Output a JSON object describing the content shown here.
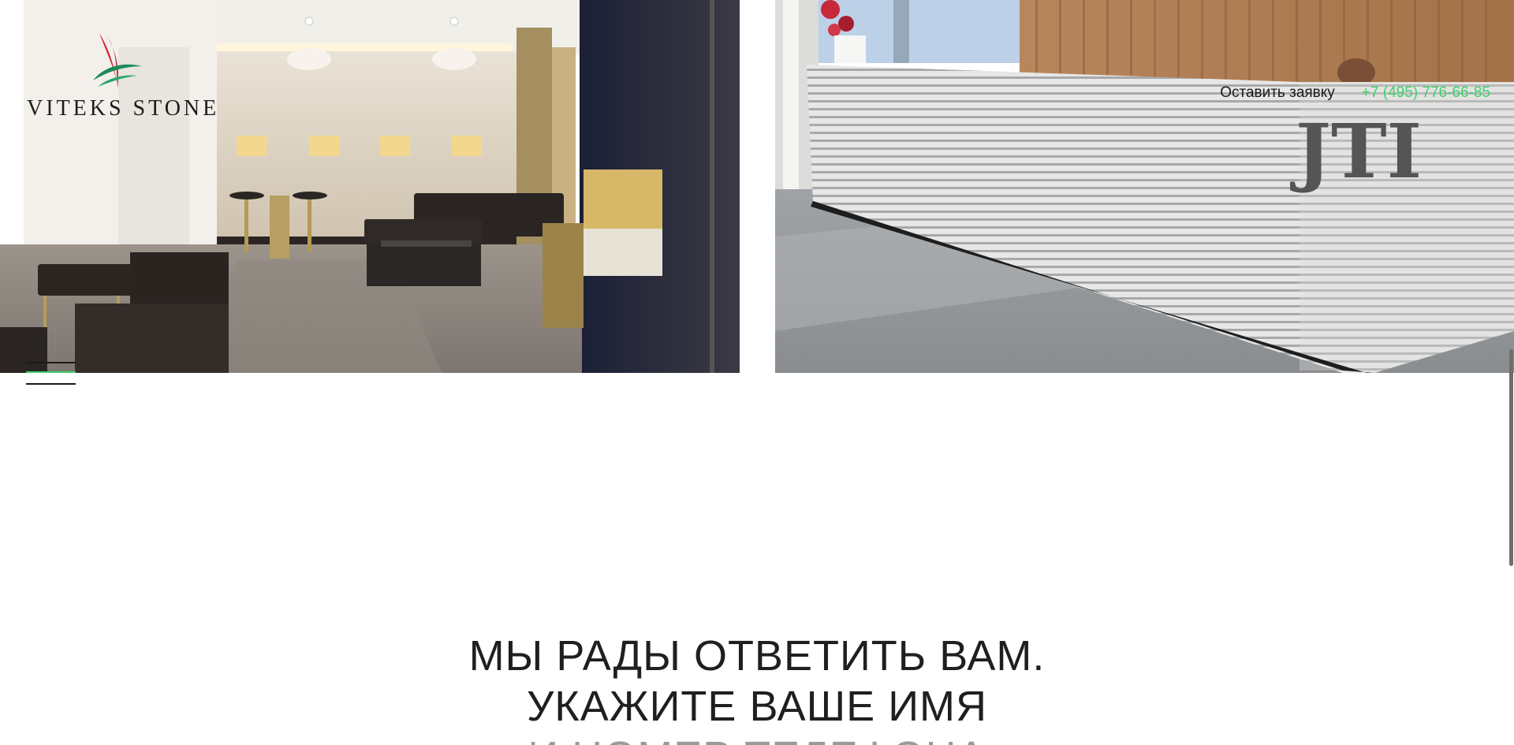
{
  "brand": {
    "logo_text": "VITEKS STONE",
    "accent_color": "#3fcf6b",
    "logo_red": "#d8263a",
    "logo_green": "#1b8a58"
  },
  "header": {
    "request_label": "Оставить заявку",
    "phone": "+7 (495) 776-66-85"
  },
  "hero_images": [
    {
      "icon": "lounge-interior-photo"
    },
    {
      "icon": "reception-desk-photo"
    }
  ],
  "menu": {
    "icon": "burger-menu-icon"
  },
  "cta": {
    "line1": "МЫ РАДЫ ОТВЕТИТЬ ВАМ.",
    "line2": "УКАЖИТЕ ВАШЕ ИМЯ",
    "line3": "И НОМЕР ТЕЛЕФОНА"
  }
}
